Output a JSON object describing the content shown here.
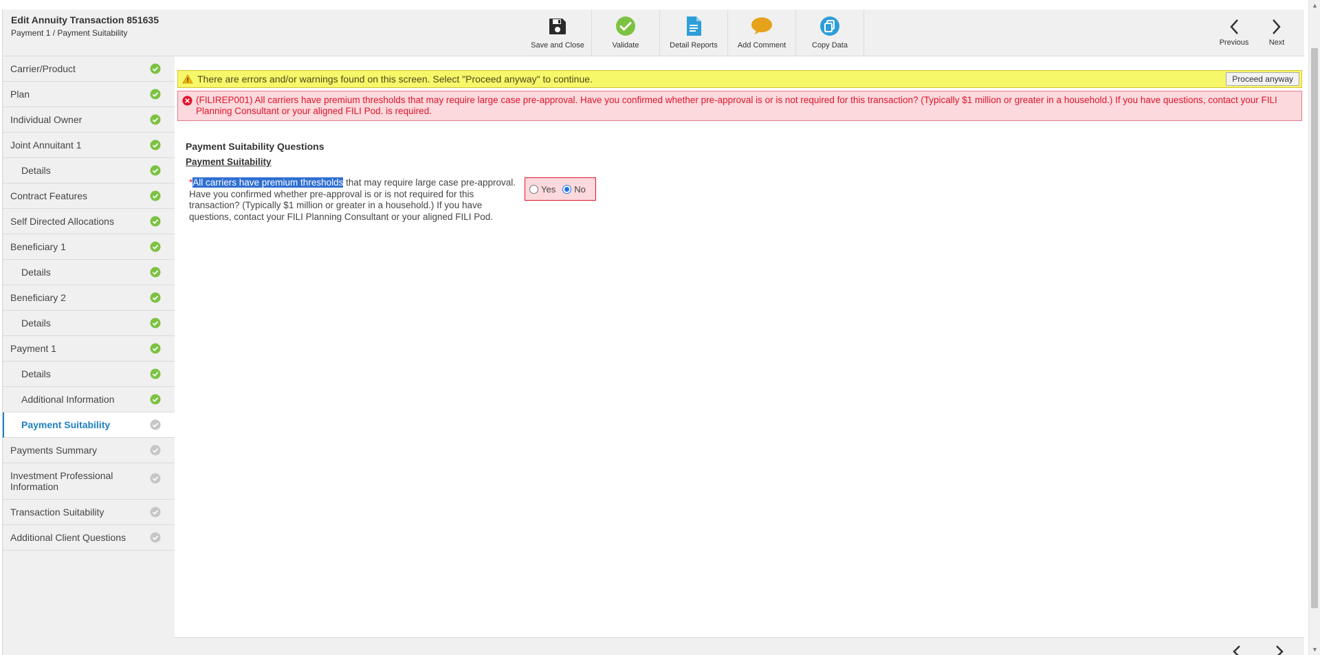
{
  "header": {
    "title": "Edit Annuity Transaction 851635",
    "subtitle": "Payment 1 / Payment Suitability"
  },
  "toolbar": {
    "save_and_close": "Save and Close",
    "validate": "Validate",
    "detail_reports": "Detail Reports",
    "add_comment": "Add Comment",
    "copy_data": "Copy Data",
    "previous": "Previous",
    "next": "Next"
  },
  "sidebar": {
    "items": [
      {
        "label": "Carrier/Product",
        "status": "complete"
      },
      {
        "label": "Plan",
        "status": "complete"
      },
      {
        "label": "Individual Owner",
        "status": "complete"
      },
      {
        "label": "Joint Annuitant 1",
        "status": "complete"
      },
      {
        "label": "Details",
        "status": "complete"
      },
      {
        "label": "Contract Features",
        "status": "complete"
      },
      {
        "label": "Self Directed Allocations",
        "status": "complete"
      },
      {
        "label": "Beneficiary 1",
        "status": "complete"
      },
      {
        "label": "Details",
        "status": "complete"
      },
      {
        "label": "Beneficiary 2",
        "status": "complete"
      },
      {
        "label": "Details",
        "status": "complete"
      },
      {
        "label": "Payment 1",
        "status": "complete"
      },
      {
        "label": "Details",
        "status": "complete"
      },
      {
        "label": "Additional Information",
        "status": "complete"
      },
      {
        "label": "Payment Suitability",
        "status": "incomplete"
      },
      {
        "label": "Payments Summary",
        "status": "incomplete"
      },
      {
        "label": "Investment Professional Information",
        "status": "incomplete"
      },
      {
        "label": "Transaction Suitability",
        "status": "incomplete"
      },
      {
        "label": "Additional Client Questions",
        "status": "incomplete"
      }
    ]
  },
  "warning": {
    "text": "There are errors and/or warnings found on this screen. Select \"Proceed anyway\" to continue.",
    "button": "Proceed anyway"
  },
  "error": {
    "text": "(FILIREP001) All carriers have premium thresholds that may require large case pre-approval. Have you confirmed whether pre-approval is or is not required for this transaction? (Typically $1 million or greater in a household.) If you have questions, contact your FILI Planning Consultant or your aligned FILI Pod. is required."
  },
  "section": {
    "title": "Payment Suitability Questions",
    "subtitle": "Payment Suitability"
  },
  "question": {
    "required_marker": "*",
    "highlighted": "All carriers have premium thresholds",
    "rest": " that may require large case pre-approval. Have you confirmed whether pre-approval is or is not required for this transaction? (Typically $1 million or greater in a household.) If you have questions, contact your FILI Planning Consultant or your aligned FILI Pod.",
    "options": [
      "Yes",
      "No"
    ],
    "selected": "No"
  },
  "colors": {
    "complete": "#7cc242",
    "incomplete": "#c6c6c6",
    "active": "#1d80c3",
    "error": "#e0142d",
    "warning_bg": "#f7f76a"
  }
}
